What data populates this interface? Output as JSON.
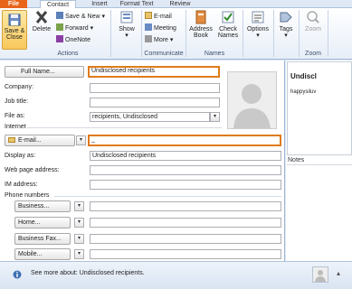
{
  "tabs": [
    "File",
    "Contact",
    "Insert",
    "Format Text",
    "Review"
  ],
  "ribbon": {
    "actions": {
      "save_close": "Save &\nClose",
      "delete": "Delete",
      "save_new": "Save & New",
      "forward": "Forward",
      "onenote": "OneNote",
      "label": "Actions"
    },
    "show": {
      "label": "Show"
    },
    "communicate": {
      "email": "E-mail",
      "meeting": "Meeting",
      "more": "More",
      "label": "Communicate"
    },
    "names": {
      "address_book": "Address\nBook",
      "check_names": "Check\nNames",
      "label": "Names"
    },
    "options": {
      "label": "Options"
    },
    "tags": {
      "label": "Tags"
    },
    "zoom": {
      "button": "Zoom",
      "label": "Zoom"
    }
  },
  "form": {
    "full_name_button": "Full Name...",
    "full_name_value": "Undisclosed recipients",
    "company_label": "Company:",
    "job_title_label": "Job title:",
    "file_as_label": "File as:",
    "file_as_value": "recipients, Undisclosed",
    "internet_section": "Internet",
    "email_button": "E-mail...",
    "email_value": "_",
    "display_as_label": "Display as:",
    "display_as_value": "Undisclosed recipients",
    "web_label": "Web page address:",
    "im_label": "IM address:",
    "phone_section": "Phone numbers",
    "business_button": "Business...",
    "home_button": "Home...",
    "business_fax_button": "Business Fax...",
    "mobile_button": "Mobile..."
  },
  "card": {
    "name": "Undiscl",
    "email": "happysiluv"
  },
  "notes_label": "Notes",
  "status": {
    "text": "See more about: Undisclosed recipients."
  }
}
